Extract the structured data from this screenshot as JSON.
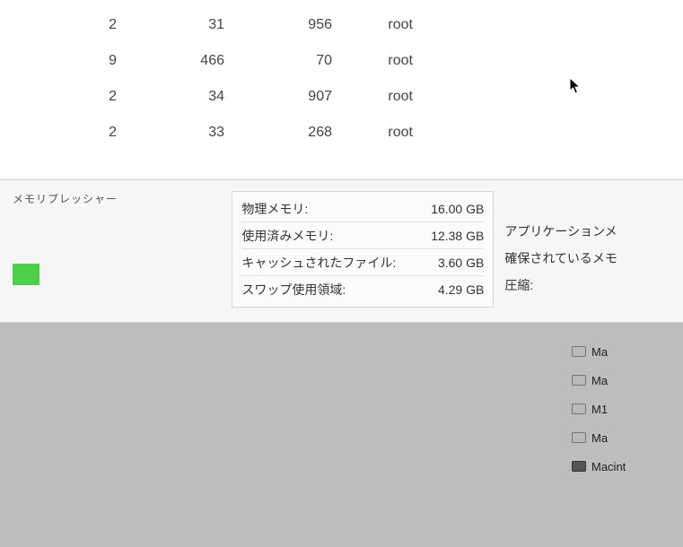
{
  "process_table": {
    "rows": [
      {
        "col1": "2",
        "col2": "31",
        "col3": "956",
        "user": "root"
      },
      {
        "col1": "9",
        "col2": "466",
        "col3": "70",
        "user": "root"
      },
      {
        "col1": "2",
        "col2": "34",
        "col3": "907",
        "user": "root"
      },
      {
        "col1": "2",
        "col2": "33",
        "col3": "268",
        "user": "root"
      }
    ]
  },
  "memory": {
    "pressure_label": "メモリプレッシャー",
    "stats": {
      "physical_label": "物理メモリ:",
      "physical_value": "16.00 GB",
      "used_label": "使用済みメモリ:",
      "used_value": "12.38 GB",
      "cached_label": "キャッシュされたファイル:",
      "cached_value": "3.60 GB",
      "swap_label": "スワップ使用領域:",
      "swap_value": "4.29 GB"
    },
    "side": {
      "app_mem": "アプリケーションメ",
      "wired_mem": "確保されているメモ",
      "compressed": "圧縮:"
    }
  },
  "finder": {
    "items": [
      {
        "name": "Ma"
      },
      {
        "name": "Ma"
      },
      {
        "name": "M1"
      },
      {
        "name": "Ma"
      },
      {
        "name": "Macint"
      }
    ]
  }
}
